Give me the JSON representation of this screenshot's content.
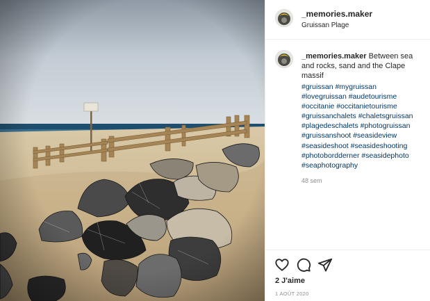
{
  "post": {
    "username": "_memories.maker",
    "location": "Gruissan Plage",
    "caption": {
      "username": "_memories.maker",
      "text": " Between sea and rocks, sand and the Clape massif"
    },
    "hashtag_lines": [
      "#gruissan #mygruissan",
      "#lovegruissan #audetourisme",
      "#occitanie #occitanietourisme",
      "#gruissanchalets #chaletsgruissan",
      "#plagedeschalets #photogruissan",
      "#gruissanshoot #seasideview",
      "#seasideshoot #seasideshooting",
      "#photobordderner #seasidephoto",
      "#seaphotography"
    ],
    "time_ago": "48 sem",
    "likes": "2 J'aime",
    "date": "1 AOÛT 2020"
  },
  "icons": {
    "like": "heart-icon",
    "comment": "comment-icon",
    "share": "paper-plane-icon"
  },
  "colors": {
    "text": "#262626",
    "hashtag": "#00376b",
    "muted": "#8e8e8e",
    "border": "#efefef"
  }
}
